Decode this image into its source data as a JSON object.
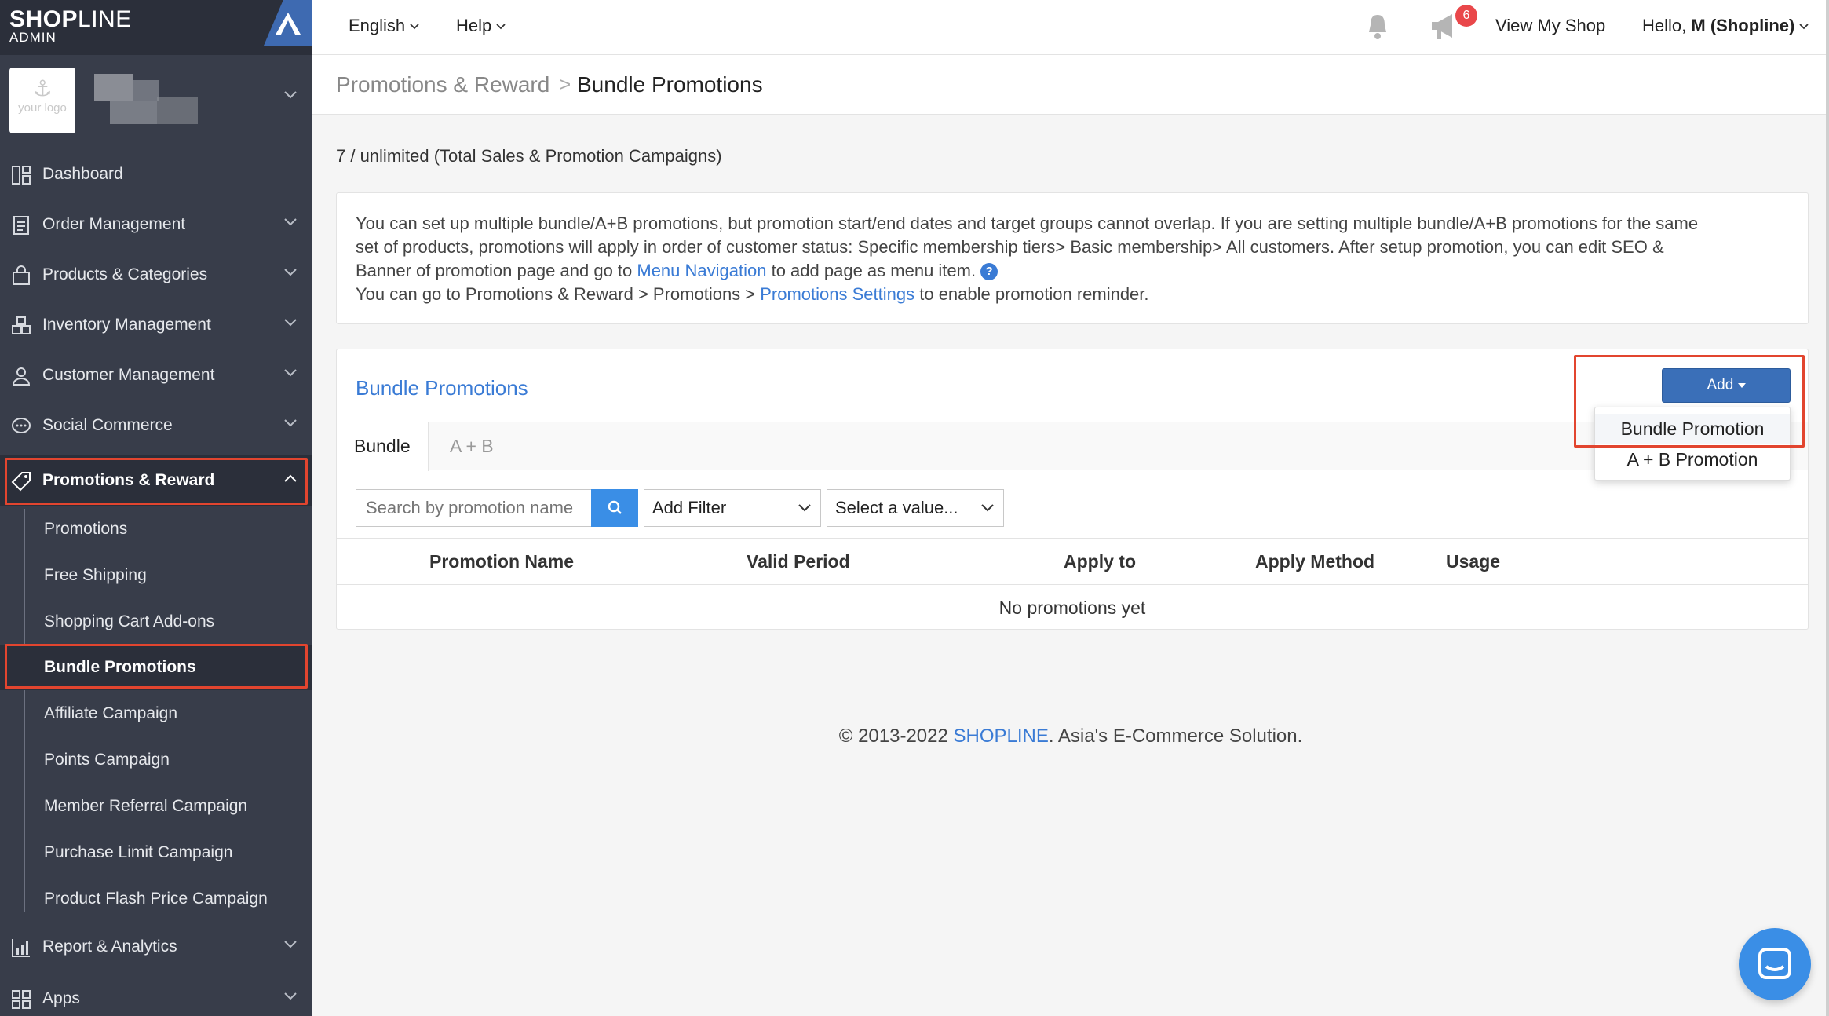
{
  "brand": {
    "logo_bold": "SHOP",
    "logo_thin": "LINE",
    "sub": "ADMIN"
  },
  "shop": {
    "logo_text": "your logo"
  },
  "sidebar": {
    "items": [
      {
        "label": "Dashboard",
        "icon": "dashboard-icon"
      },
      {
        "label": "Order Management",
        "icon": "order-icon"
      },
      {
        "label": "Products & Categories",
        "icon": "bag-icon"
      },
      {
        "label": "Inventory Management",
        "icon": "inventory-icon"
      },
      {
        "label": "Customer Management",
        "icon": "user-icon"
      },
      {
        "label": "Social Commerce",
        "icon": "chat-bubble-icon"
      },
      {
        "label": "Promotions & Reward",
        "icon": "tag-icon"
      },
      {
        "label": "Report & Analytics",
        "icon": "chart-icon"
      },
      {
        "label": "Apps",
        "icon": "apps-icon"
      }
    ],
    "sub_items": [
      "Promotions",
      "Free Shipping",
      "Shopping Cart Add-ons",
      "Bundle Promotions",
      "Affiliate Campaign",
      "Points Campaign",
      "Member Referral Campaign",
      "Purchase Limit Campaign",
      "Product Flash Price Campaign"
    ]
  },
  "topbar": {
    "language": "English",
    "help": "Help",
    "notification_count": "6",
    "view_shop": "View My Shop",
    "greeting": "Hello,",
    "user": "M (Shopline)"
  },
  "breadcrumb": {
    "parent": "Promotions & Reward",
    "separator": ">",
    "current": "Bundle Promotions"
  },
  "usage": "7 / unlimited (Total Sales & Promotion Campaigns)",
  "info": {
    "line1": "You can set up multiple bundle/A+B promotions, but promotion start/end dates and target groups cannot overlap. If you are setting multiple bundle/A+B promotions for the same",
    "line2": "set of products, promotions will apply in order of customer status: Specific membership tiers> Basic membership> All customers. After setup promotion, you can edit SEO &",
    "line3_pre": "Banner of promotion page and go to ",
    "line3_link": "Menu Navigation",
    "line3_post": " to add page as menu item.",
    "qmark": "?",
    "line4_pre": "You can go to Promotions & Reward > Promotions > ",
    "line4_link": "Promotions Settings",
    "line4_post": " to enable promotion reminder."
  },
  "panel": {
    "title": "Bundle Promotions",
    "tabs": [
      "Bundle",
      "A + B"
    ],
    "search_placeholder": "Search by promotion name",
    "filter_label": "Add Filter",
    "value_label": "Select a value...",
    "columns": [
      "Promotion Name",
      "Valid Period",
      "Apply to",
      "Apply Method",
      "Usage"
    ],
    "empty": "No promotions yet"
  },
  "add": {
    "label": "Add",
    "menu": [
      "Bundle Promotion",
      "A + B Promotion"
    ]
  },
  "footer": {
    "pre": "© 2013-2022 ",
    "brand": "SHOPLINE",
    "post": ". Asia's E-Commerce Solution."
  },
  "colors": {
    "sidebar_bg": "#383d4a",
    "accent": "#3a7bd5",
    "highlight": "#e2452f"
  }
}
